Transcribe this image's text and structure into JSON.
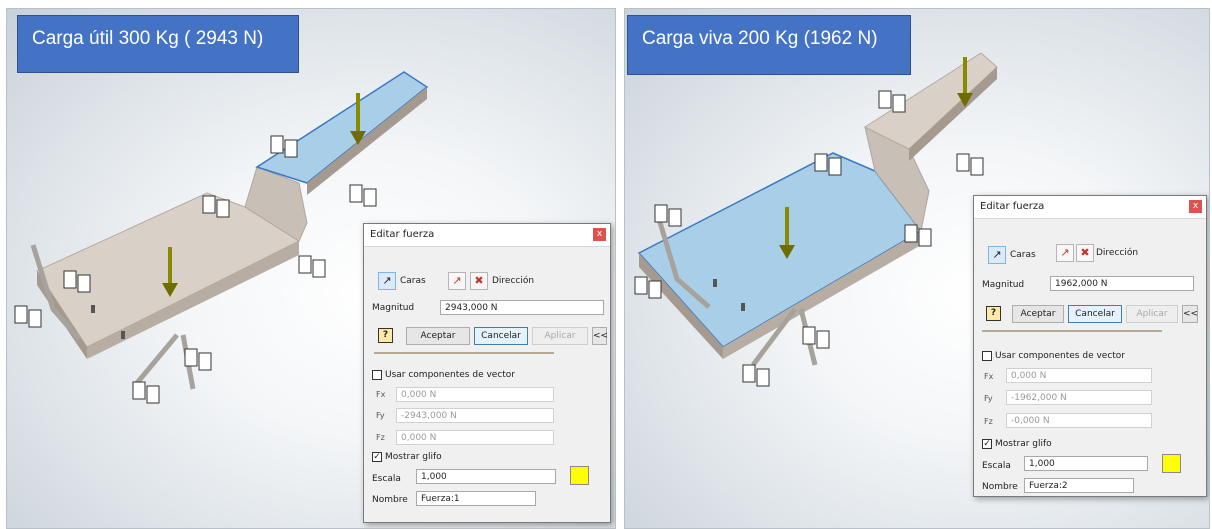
{
  "left": {
    "banner": "Carga útil 300 Kg ( 2943 N)",
    "dialog": {
      "title": "Editar fuerza",
      "close": "x",
      "faces_label": "Caras",
      "direction_label": "Dirección",
      "magnitude_label": "Magnitud",
      "magnitude_value": "2943,000 N",
      "help": "?",
      "accept": "Aceptar",
      "cancel": "Cancelar",
      "apply": "Aplicar",
      "collapse": "<<",
      "vector_label": "Usar componentes de vector",
      "vector_checked": false,
      "fx_label": "Fx",
      "fx_value": "0,000 N",
      "fy_label": "Fy",
      "fy_value": "-2943,000 N",
      "fz_label": "Fz",
      "fz_value": "0,000 N",
      "glyph_label": "Mostrar glifo",
      "glyph_checked": true,
      "scale_label": "Escala",
      "scale_value": "1,000",
      "name_label": "Nombre",
      "name_value": "Fuerza:1",
      "swatch_color": "#ffff00"
    }
  },
  "right": {
    "banner": "Carga viva 200 Kg (1962 N)",
    "dialog": {
      "title": "Editar fuerza",
      "close": "x",
      "faces_label": "Caras",
      "direction_label": "Dirección",
      "magnitude_label": "Magnitud",
      "magnitude_value": "1962,000 N",
      "help": "?",
      "accept": "Aceptar",
      "cancel": "Cancelar",
      "apply": "Aplicar",
      "collapse": "<<",
      "vector_label": "Usar componentes de vector",
      "vector_checked": false,
      "fx_label": "Fx",
      "fx_value": "0,000 N",
      "fy_label": "Fy",
      "fy_value": "-1962,000 N",
      "fz_label": "Fz",
      "fz_value": "-0,000 N",
      "glyph_label": "Mostrar glifo",
      "glyph_checked": true,
      "scale_label": "Escala",
      "scale_value": "1,000",
      "name_label": "Nombre",
      "name_value": "Fuerza:2",
      "swatch_color": "#ffff00"
    }
  },
  "colors": {
    "banner": "#4472c4",
    "selected_face": "#a9cfe8",
    "platform": "#d9d0c7",
    "force_arrow": "#8a8a00"
  },
  "icons": [
    "constraint-glyph-icon",
    "force-arrow-icon",
    "select-faces-icon",
    "select-direction-icon",
    "flip-direction-icon",
    "help-icon"
  ]
}
